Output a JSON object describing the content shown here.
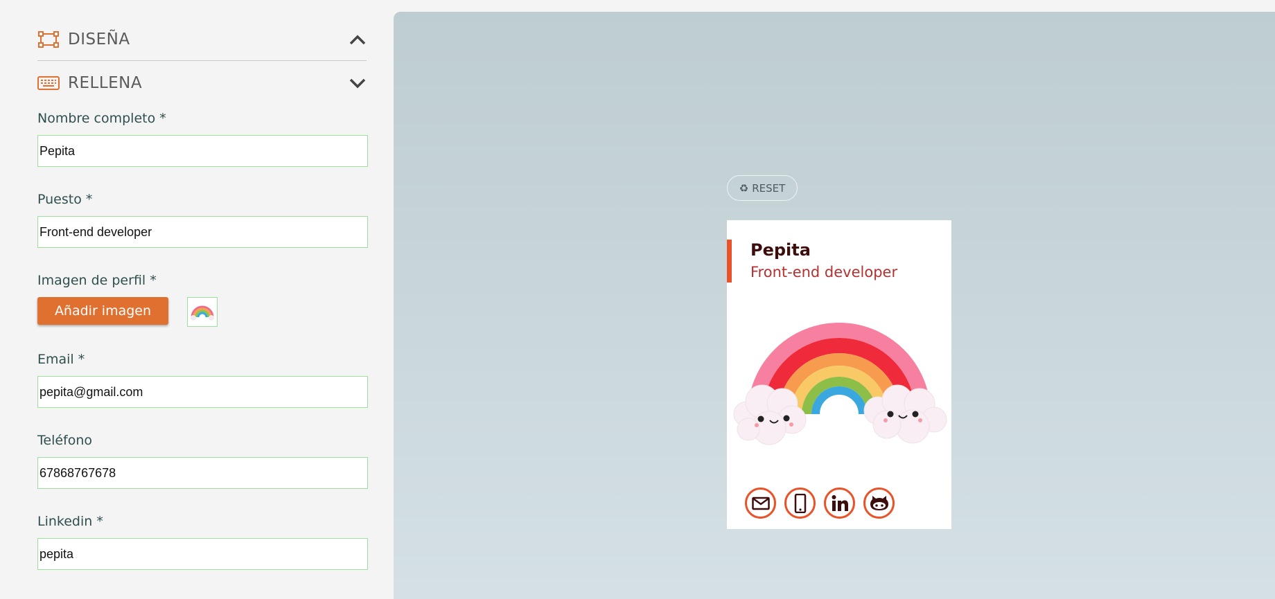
{
  "sections": {
    "design": {
      "title": "DISEÑA",
      "icon": "palette-frame-icon",
      "expanded": true
    },
    "fill": {
      "title": "RELLENA",
      "icon": "keyboard-icon",
      "expanded": false
    }
  },
  "form": {
    "name": {
      "label": "Nombre completo *",
      "value": "Pepita"
    },
    "job": {
      "label": "Puesto *",
      "value": "Front-end developer"
    },
    "image": {
      "label": "Imagen de perfil *",
      "button": "Añadir imagen"
    },
    "email": {
      "label": "Email *",
      "value": "pepita@gmail.com"
    },
    "phone": {
      "label": "Teléfono",
      "value": "67868767678"
    },
    "linkedin": {
      "label": "Linkedin *",
      "value": "pepita"
    }
  },
  "preview": {
    "reset_label": "RESET",
    "card": {
      "name": "Pepita",
      "job": "Front-end developer",
      "accent": "#e8542a",
      "social_icons": [
        "mail-icon",
        "phone-icon",
        "linkedin-icon",
        "github-icon"
      ]
    }
  },
  "colors": {
    "accent": "#e07030",
    "input_border": "#9be09b",
    "name_color": "#3d0d0d",
    "job_color": "#b5312f"
  }
}
